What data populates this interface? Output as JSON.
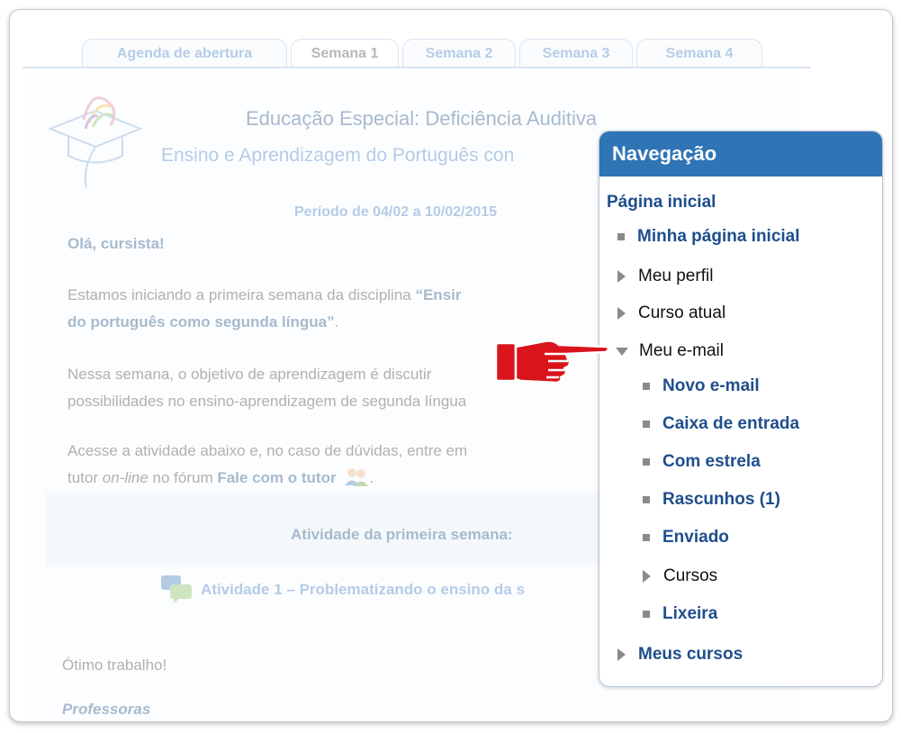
{
  "tabs": [
    {
      "label": "Agenda de abertura"
    },
    {
      "label": "Semana 1"
    },
    {
      "label": "Semana 2"
    },
    {
      "label": "Semana 3"
    },
    {
      "label": "Semana 4"
    }
  ],
  "course": {
    "title": "Educação Especial: Deficiência Auditiva",
    "subtitle": "Ensino e Aprendizagem do Português con",
    "period": "Período de 04/02 a 10/02/2015",
    "greeting": "Olá, cursista!",
    "paragraph1_line1": "Estamos iniciando a primeira semana da disciplina ",
    "paragraph1_bold1": "“Ensir",
    "paragraph1_line2": "do português como segunda língua”",
    "paragraph1_end": ".",
    "paragraph2_line1": "Nessa semana, o objetivo de aprendizagem é discutir",
    "paragraph2_line2": "possibilidades no ensino-aprendizagem de segunda língua",
    "paragraph3_line1": "Acesse a atividade abaixo e, no caso de dúvidas, entre em",
    "paragraph3_pre": "tutor ",
    "paragraph3_italic": "on-line",
    "paragraph3_mid": " no fórum ",
    "paragraph3_link": "Fale com o tutor",
    "paragraph3_end": ".",
    "activity_heading": "Atividade da primeira semana:",
    "activity_link": "Atividade 1 – Problematizando o ensino da s",
    "closing": "Ótimo trabalho!",
    "signature": "Professoras"
  },
  "navigation": {
    "header": "Navegação",
    "items": [
      {
        "label": "Página inicial"
      },
      {
        "label": "Minha página inicial"
      },
      {
        "label": "Meu perfil"
      },
      {
        "label": "Curso atual"
      },
      {
        "label": "Meu e-mail"
      },
      {
        "label": "Novo e-mail"
      },
      {
        "label": "Caixa de entrada"
      },
      {
        "label": "Com estrela"
      },
      {
        "label": "Rascunhos (1)"
      },
      {
        "label": "Enviado"
      },
      {
        "label": "Cursos"
      },
      {
        "label": "Lixeira"
      },
      {
        "label": "Meus cursos"
      }
    ]
  },
  "colors": {
    "nav_header": "#2f74b5",
    "link": "#1f4e8c",
    "pointer_hand": "#d9141b"
  }
}
